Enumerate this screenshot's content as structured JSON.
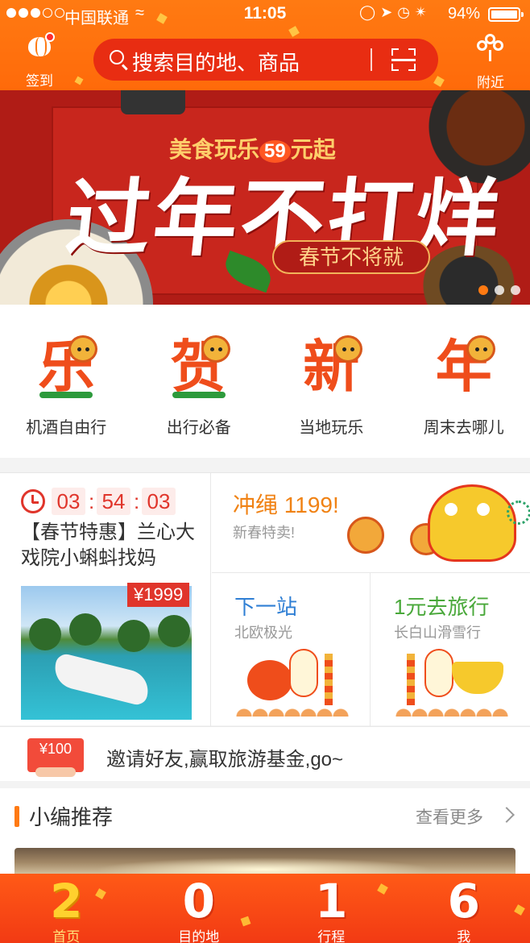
{
  "status_bar": {
    "carrier": "中国联通",
    "time": "11:05",
    "battery": "94%"
  },
  "header": {
    "checkin_label": "签到",
    "search_placeholder": "搜索目的地、商品",
    "nearby_label": "附近"
  },
  "banner": {
    "subtitle_prefix": "美食玩乐",
    "subtitle_price": "59",
    "subtitle_suffix": "元起",
    "headline": "过年不打烊",
    "tagline": "春节不将就"
  },
  "categories": [
    {
      "label": "机酒自由行",
      "glyph": "乐"
    },
    {
      "label": "出行必备",
      "glyph": "贺"
    },
    {
      "label": "当地玩乐",
      "glyph": "新"
    },
    {
      "label": "周末去哪儿",
      "glyph": "年"
    }
  ],
  "flash_deal": {
    "countdown": {
      "h": "03",
      "m": "54",
      "s": "03"
    },
    "title": "【春节特惠】兰心大戏院小蝌蚪找妈",
    "price": "¥1999"
  },
  "promo_main": {
    "title": "冲绳 1199!",
    "subtitle": "新春特卖!"
  },
  "promo_cards": [
    {
      "title": "下一站",
      "subtitle": "北欧极光",
      "color": "#2f7fd4"
    },
    {
      "title": "1元去旅行",
      "subtitle": "长白山滑雪行",
      "color": "#49a83a"
    }
  ],
  "invite": {
    "badge": "¥100",
    "text": "邀请好友,赢取旅游基金,go~"
  },
  "recommend": {
    "title": "小编推荐",
    "more": "查看更多"
  },
  "tabs": [
    {
      "num": "2",
      "label": "首页",
      "active": true
    },
    {
      "num": "0",
      "label": "目的地",
      "active": false
    },
    {
      "num": "1",
      "label": "行程",
      "active": false
    },
    {
      "num": "6",
      "label": "我",
      "active": false
    }
  ],
  "colors": {
    "brand_orange": "#ff7a12",
    "search_red": "#e82d12",
    "deal_red": "#e0352b",
    "promo_orange": "#f08214"
  }
}
